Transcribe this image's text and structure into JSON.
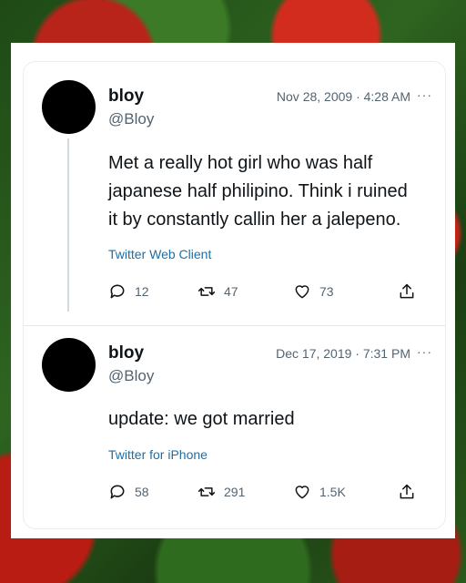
{
  "tweets": [
    {
      "name": "bloy",
      "handle": "@Bloy",
      "date": "Nov 28, 2009 · 4:28 AM",
      "more": "···",
      "text_lines": [
        "Met a really hot girl who was half",
        "japanese half philipino. Think i ruined",
        "it by constantly callin her a jalepeno."
      ],
      "source": "Twitter Web Client",
      "replies": "12",
      "retweets": "47",
      "likes": "73"
    },
    {
      "name": "bloy",
      "handle": "@Bloy",
      "date": "Dec 17, 2019 · 7:31 PM",
      "more": "···",
      "text_lines": [
        "update: we got married"
      ],
      "source": "Twitter for iPhone",
      "replies": "58",
      "retweets": "291",
      "likes": "1.5K"
    }
  ],
  "icons": {
    "reply": "speech-bubble-icon",
    "retweet": "retweet-arrows-icon",
    "like": "heart-icon",
    "share": "share-upload-icon"
  },
  "colors": {
    "text": "#0f1419",
    "secondary": "#536471",
    "source_link": "#1d6fa5"
  }
}
